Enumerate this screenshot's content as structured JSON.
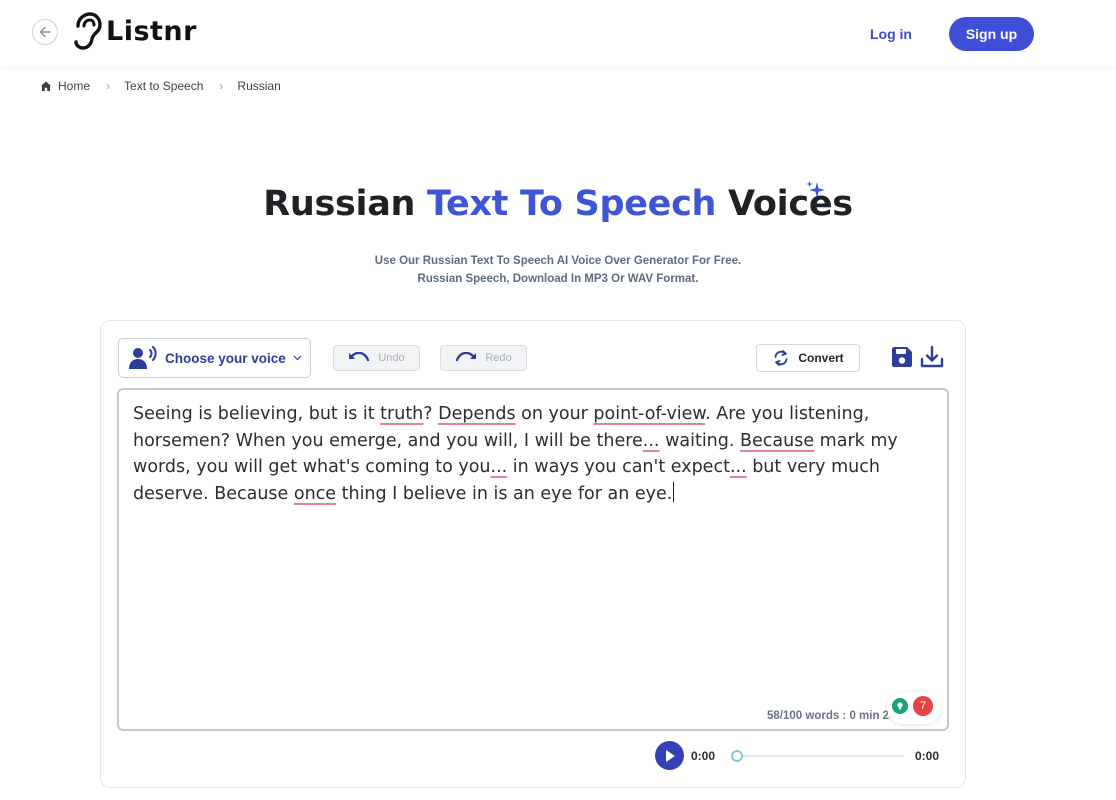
{
  "header": {
    "logo_text": "Listnr",
    "login_label": "Log in",
    "signup_label": "Sign up",
    "accent_color": "#3f4fd8"
  },
  "breadcrumb": {
    "items": [
      "Home",
      "Text to Speech",
      "Russian"
    ]
  },
  "hero": {
    "title_prefix": "Russian ",
    "title_accent": "Text To Speech",
    "title_suffix": " Voices",
    "subtitle_line1": "Use Our Russian Text To Speech AI Voice Over Generator For Free.",
    "subtitle_line2": "Russian Speech, Download In MP3 Or WAV Format."
  },
  "toolbar": {
    "voice_label": "Choose your voice",
    "undo_label": "Undo",
    "redo_label": "Redo",
    "convert_label": "Convert"
  },
  "editor": {
    "segments": [
      {
        "text": "Seeing is believing, but is it ",
        "flag": false
      },
      {
        "text": "truth",
        "flag": true
      },
      {
        "text": "? ",
        "flag": false
      },
      {
        "text": "Depends",
        "flag": true
      },
      {
        "text": " on your ",
        "flag": false
      },
      {
        "text": "point-of-view",
        "flag": true
      },
      {
        "text": ". Are you listening, horsemen? When you emerge, and you will, I will be there",
        "flag": false
      },
      {
        "text": "...",
        "flag": true
      },
      {
        "text": " waiting. ",
        "flag": false
      },
      {
        "text": "Because",
        "flag": true
      },
      {
        "text": " mark my words, you will get what's coming to you",
        "flag": false
      },
      {
        "text": "...",
        "flag": true
      },
      {
        "text": " in ways you can't expect",
        "flag": false
      },
      {
        "text": "...",
        "flag": true
      },
      {
        "text": " but very much deserve. Because ",
        "flag": false
      },
      {
        "text": "once",
        "flag": true
      },
      {
        "text": " thing I believe in is an eye for an eye.",
        "flag": false
      }
    ],
    "word_count": "58/100 words : 0 min 24",
    "badge_count": "7"
  },
  "player": {
    "current_time": "0:00",
    "duration": "0:00",
    "progress": 0
  }
}
